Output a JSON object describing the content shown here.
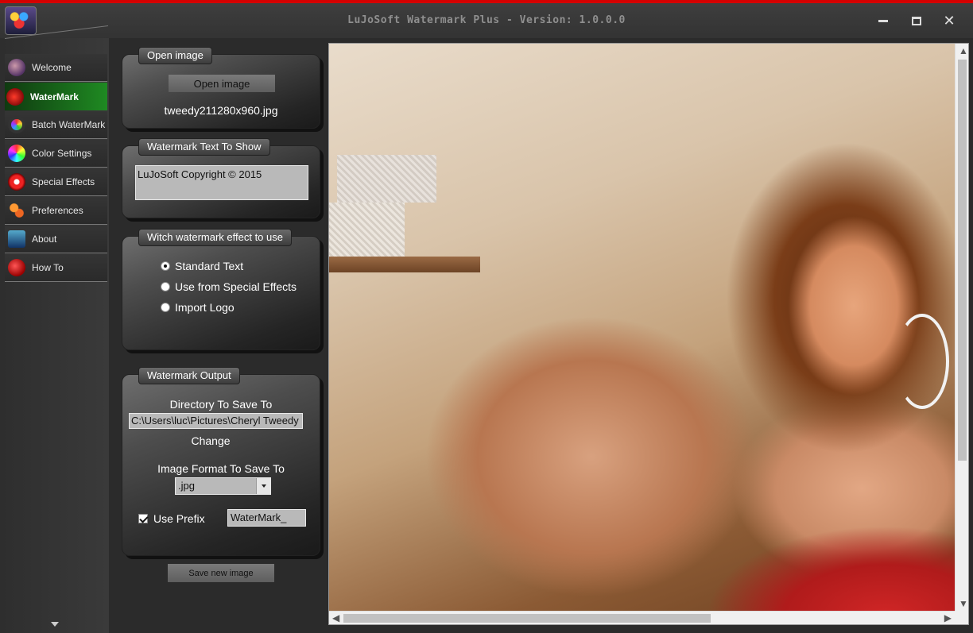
{
  "window": {
    "title": "LuJoSoft Watermark Plus - Version: 1.0.0.0",
    "minimize_icon": "minimize-icon",
    "maximize_icon": "maximize-icon",
    "close_label": "✕"
  },
  "colors": {
    "accent_red": "#d40000",
    "active_green": "#1f8a22",
    "panel_dark": "#252525"
  },
  "sidebar": {
    "items": [
      {
        "label": "Welcome",
        "icon": "welcome-icon",
        "active": false
      },
      {
        "label": "WaterMark",
        "icon": "watermark-icon",
        "active": true
      },
      {
        "label": "Batch WaterMark",
        "icon": "batch-icon",
        "active": false
      },
      {
        "label": "Color Settings",
        "icon": "color-icon",
        "active": false
      },
      {
        "label": "Special Effects",
        "icon": "effects-icon",
        "active": false
      },
      {
        "label": "Preferences",
        "icon": "preferences-icon",
        "active": false
      },
      {
        "label": "About",
        "icon": "about-icon",
        "active": false
      },
      {
        "label": "How To",
        "icon": "howto-icon",
        "active": false
      }
    ]
  },
  "open_image": {
    "title": "Open image",
    "button_label": "Open image",
    "file_name": "tweedy211280x960.jpg"
  },
  "watermark_text": {
    "title": "Watermark Text To Show",
    "value": "LuJoSoft Copyright ©  2015"
  },
  "effect": {
    "title": "Witch watermark effect to use",
    "options": [
      {
        "label": "Standard Text",
        "checked": true
      },
      {
        "label": "Use from Special Effects",
        "checked": false
      },
      {
        "label": "Import Logo",
        "checked": false
      }
    ]
  },
  "output": {
    "title": "Watermark Output",
    "directory_label": "Directory To Save To",
    "directory_value": "C:\\Users\\luc\\Pictures\\Cheryl Tweedy",
    "change_label": "Change",
    "format_label": "Image Format To Save To",
    "format_value": ".jpg",
    "use_prefix_label": "Use Prefix",
    "use_prefix_checked": true,
    "prefix_value": "WaterMark_"
  },
  "save_button_label": "Save new image"
}
